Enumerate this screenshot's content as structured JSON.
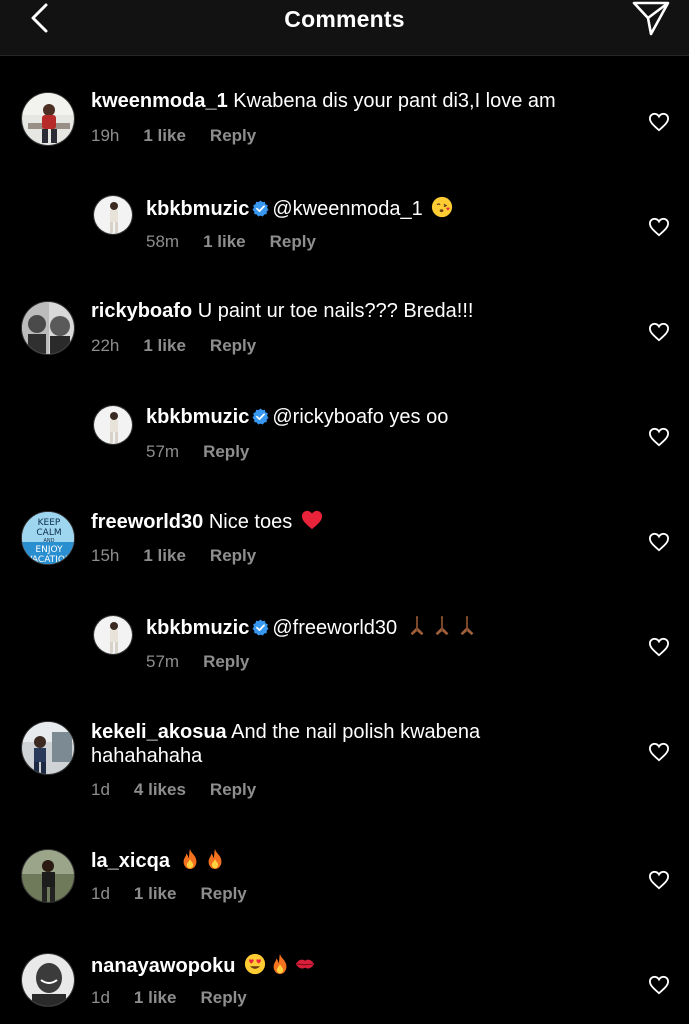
{
  "header": {
    "title": "Comments",
    "back_icon": "chevron-left-icon",
    "share_icon": "paper-plane-icon"
  },
  "comments": [
    {
      "username": "kweenmoda_1",
      "text": "Kwabena dis your pant di3,I love am",
      "time": "19h",
      "likes": "1 like",
      "reply": "Reply"
    },
    {
      "username": "kbkbmuzic",
      "mention": "@kweenmoda_1",
      "emojis": [
        "kissing-face"
      ],
      "time": "58m",
      "likes": "1 like",
      "reply": "Reply"
    },
    {
      "username": "rickyboafo",
      "text": "U paint ur toe nails??? Breda!!!",
      "time": "22h",
      "likes": "1 like",
      "reply": "Reply"
    },
    {
      "username": "kbkbmuzic",
      "mention": "@rickyboafo",
      "text": "yes oo",
      "time": "57m",
      "reply": "Reply"
    },
    {
      "username": "freeworld30",
      "text": "Nice toes",
      "emojis": [
        "red-heart"
      ],
      "avatar_text": [
        "KEEP",
        "CALM",
        "AND",
        "ENJOY",
        "VACATION"
      ],
      "time": "15h",
      "likes": "1 like",
      "reply": "Reply"
    },
    {
      "username": "kbkbmuzic",
      "mention": "@freeworld30",
      "emojis": [
        "folded-hands",
        "folded-hands",
        "folded-hands"
      ],
      "time": "57m",
      "reply": "Reply"
    },
    {
      "username": "kekeli_akosua",
      "text": "And the nail polish kwabena hahahahaha",
      "time": "1d",
      "likes": "4 likes",
      "reply": "Reply"
    },
    {
      "username": "la_xicqa",
      "emojis": [
        "fire",
        "fire"
      ],
      "time": "1d",
      "likes": "1 like",
      "reply": "Reply"
    },
    {
      "username": "nanayawopoku",
      "emojis": [
        "heart-eyes",
        "fire",
        "kiss-mark"
      ],
      "time": "1d",
      "likes": "1 like",
      "reply": "Reply"
    }
  ],
  "colors": {
    "background": "#000000",
    "header": "#121212",
    "meta_text": "#8e8e8e",
    "verified": "#3897f0"
  }
}
